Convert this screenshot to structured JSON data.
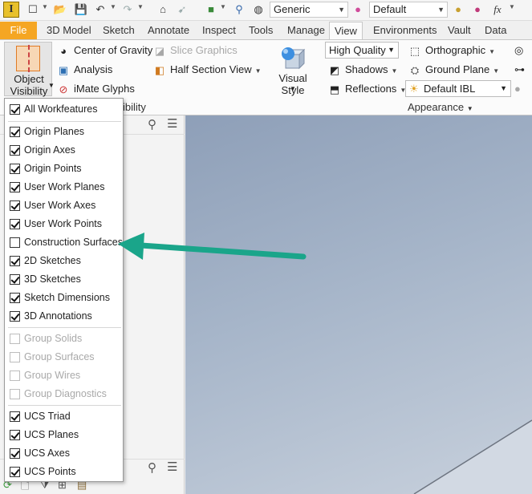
{
  "quick_access": {
    "app_logo": "I",
    "material_select": "Generic",
    "appearance_select": "Default",
    "fx": "fx",
    "icons": [
      "app-logo-icon",
      "new-file-icon",
      "open-icon",
      "save-icon",
      "undo-icon",
      "redo-icon",
      "home-icon",
      "select-icon",
      "color-fill-icon",
      "parameters-icon",
      "adjust-icon",
      "material-icon",
      "appearance-color-icon",
      "clear-appearance-icon",
      "fx-icon"
    ]
  },
  "tabs": [
    "File",
    "3D Model",
    "Sketch",
    "Annotate",
    "Inspect",
    "Tools",
    "Manage",
    "View",
    "Environments",
    "Vault",
    "Data Stand"
  ],
  "active_tab": "View",
  "ribbon": {
    "object_visibility": {
      "line1": "Object",
      "line2": "Visibility"
    },
    "center_of_gravity": "Center of Gravity",
    "analysis": "Analysis",
    "imate_glyphs": "iMate Glyphs",
    "slice_graphics": "Slice Graphics",
    "half_section_view": "Half Section View",
    "visibility_label_fragment": "ibility",
    "visual_style": "Visual Style",
    "quality_select": "High Quality",
    "shadows": "Shadows",
    "reflections": "Reflections",
    "orthographic": "Orthographic",
    "ground_plane": "Ground Plane",
    "ibl_select": "Default IBL",
    "appearance_label": "Appearance"
  },
  "menu": {
    "groups": [
      [
        {
          "label": "All Workfeatures",
          "checked": true,
          "enabled": true
        }
      ],
      [
        {
          "label": "Origin Planes",
          "checked": true,
          "enabled": true
        },
        {
          "label": "Origin Axes",
          "checked": true,
          "enabled": true
        },
        {
          "label": "Origin Points",
          "checked": true,
          "enabled": true
        },
        {
          "label": "User Work Planes",
          "checked": true,
          "enabled": true
        },
        {
          "label": "User Work Axes",
          "checked": true,
          "enabled": true
        },
        {
          "label": "User Work Points",
          "checked": true,
          "enabled": true
        },
        {
          "label": "Construction Surfaces",
          "checked": false,
          "enabled": true
        },
        {
          "label": "2D Sketches",
          "checked": true,
          "enabled": true
        },
        {
          "label": "3D Sketches",
          "checked": true,
          "enabled": true
        },
        {
          "label": "Sketch Dimensions",
          "checked": true,
          "enabled": true
        },
        {
          "label": "3D Annotations",
          "checked": true,
          "enabled": true
        }
      ],
      [
        {
          "label": "Group Solids",
          "checked": false,
          "enabled": false
        },
        {
          "label": "Group Surfaces",
          "checked": false,
          "enabled": false
        },
        {
          "label": "Group Wires",
          "checked": false,
          "enabled": false
        },
        {
          "label": "Group Diagnostics",
          "checked": false,
          "enabled": false
        }
      ],
      [
        {
          "label": "UCS Triad",
          "checked": true,
          "enabled": true
        },
        {
          "label": "UCS Planes",
          "checked": true,
          "enabled": true
        },
        {
          "label": "UCS Axes",
          "checked": true,
          "enabled": true
        },
        {
          "label": "UCS Points",
          "checked": true,
          "enabled": true
        }
      ]
    ]
  },
  "colors": {
    "file_tab": "#f5a623",
    "arrow": "#1aa58a",
    "viewport_top": "#8e9fb8",
    "viewport_bottom": "#c7d0dc"
  }
}
